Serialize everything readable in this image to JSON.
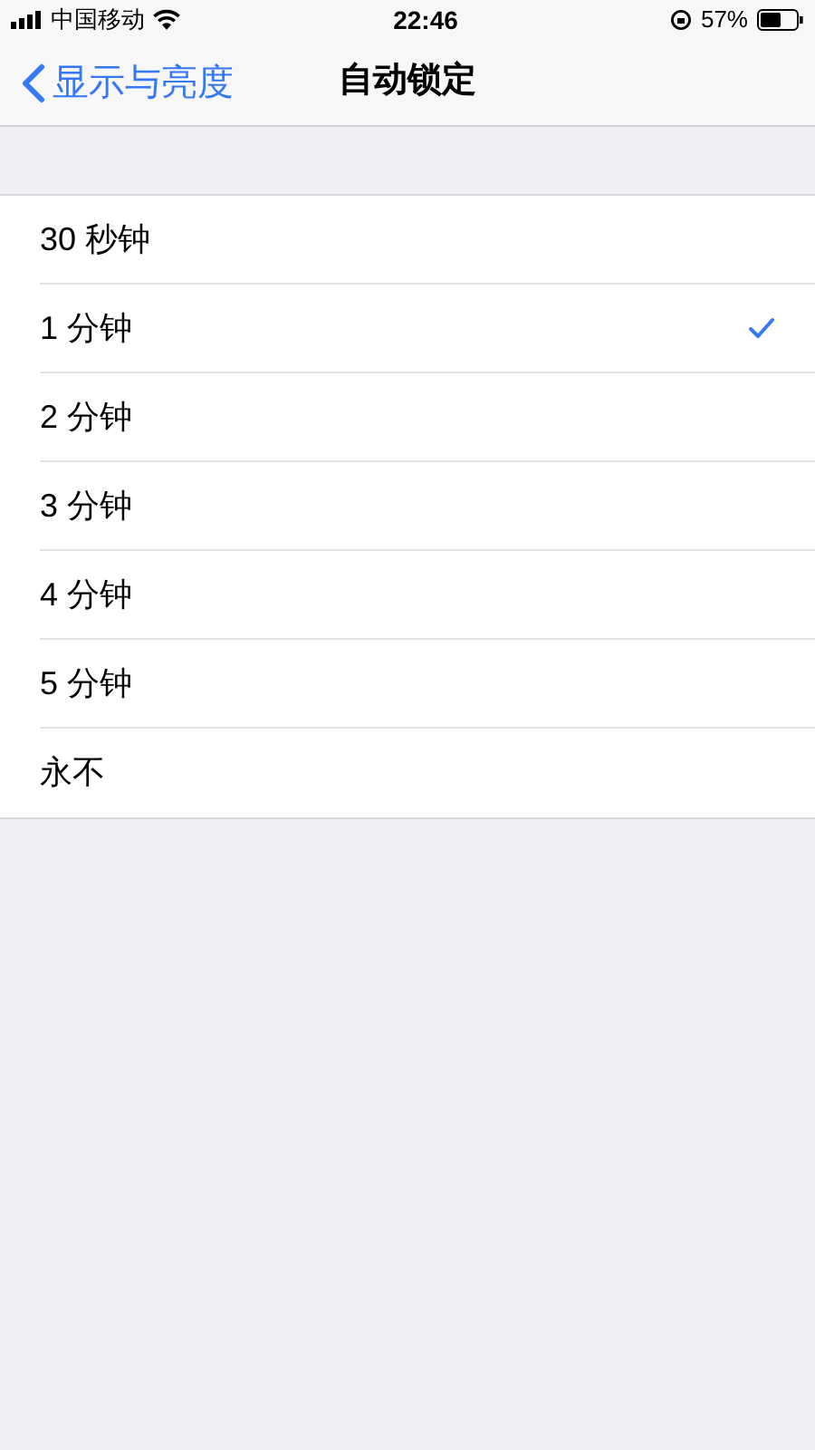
{
  "status_bar": {
    "carrier": "中国移动",
    "time": "22:46",
    "battery": "57%"
  },
  "nav": {
    "back": "显示与亮度",
    "title": "自动锁定"
  },
  "options": [
    {
      "label": "30 秒钟",
      "selected": false
    },
    {
      "label": "1 分钟",
      "selected": true
    },
    {
      "label": "2 分钟",
      "selected": false
    },
    {
      "label": "3 分钟",
      "selected": false
    },
    {
      "label": "4 分钟",
      "selected": false
    },
    {
      "label": "5 分钟",
      "selected": false
    },
    {
      "label": "永不",
      "selected": false
    }
  ]
}
